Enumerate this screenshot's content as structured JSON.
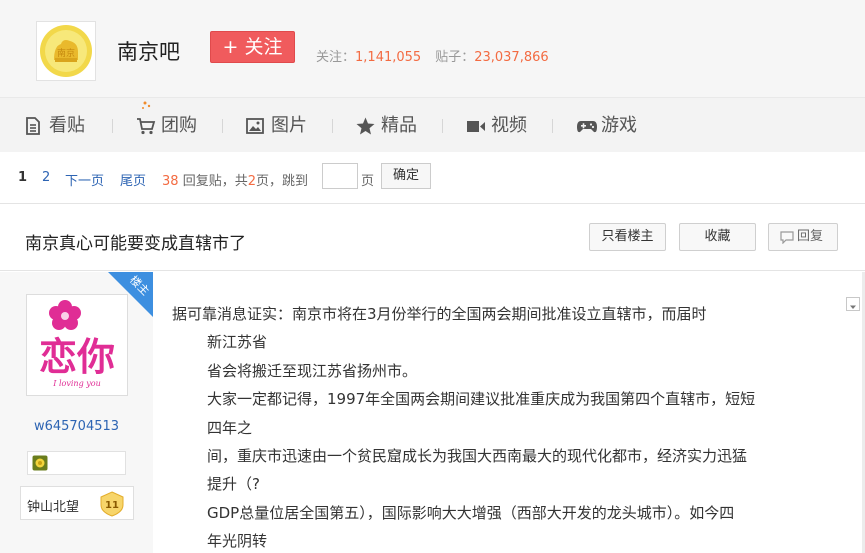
{
  "forum": {
    "name": "南京吧",
    "follow_label": "+ 关注",
    "follow_count_label": "关注：",
    "follow_count": "1,141,055",
    "post_count_label": "贴子：",
    "post_count": "23,037,866"
  },
  "nav": {
    "items": [
      {
        "label": "看贴",
        "icon": "document-icon"
      },
      {
        "label": "团购",
        "icon": "cart-icon"
      },
      {
        "label": "图片",
        "icon": "image-icon"
      },
      {
        "label": "精品",
        "icon": "star-icon"
      },
      {
        "label": "视频",
        "icon": "video-icon"
      },
      {
        "label": "游戏",
        "icon": "gamepad-icon"
      }
    ]
  },
  "pager": {
    "current": "1",
    "page2": "2",
    "next": "下一页",
    "last": "尾页",
    "reply_count": "38",
    "reply_label": "回复贴，共",
    "total_pages": "2",
    "pages_label": "页，跳到",
    "page_unit": "页",
    "confirm": "确定",
    "jump_value": ""
  },
  "thread": {
    "title": "南京真心可能要变成直辖市了",
    "only_op": "只看楼主",
    "favorite": "收藏",
    "reply": "回复"
  },
  "author": {
    "badge": "楼主",
    "username": "w645704513",
    "level_name": "钟山北望",
    "level": "11",
    "avatar_text": "恋你",
    "avatar_sub": "I loving you"
  },
  "post": {
    "lines": [
      "据可靠消息证实：南京市将在3月份举行的全国两会期间批准设立直辖市，而届时",
      "新江苏省",
      "省会将搬迁至现江苏省扬州市。",
      "大家一定都记得，1997年全国两会期间建议批准重庆成为我国第四个直辖市，短短",
      "四年之",
      "间，重庆市迅速由一个贫民窟成长为我国大西南最大的现代化都市，经济实力迅猛",
      "提升（?",
      "GDP总量位居全国第五），国际影响大大增强（西部大开发的龙头城市）。如今四",
      "年光阴转"
    ]
  },
  "colors": {
    "accent_red": "#f05b5d",
    "link_blue": "#2d64b3",
    "number_orange": "#f36b42",
    "badge_blue": "#3d8fe0"
  }
}
